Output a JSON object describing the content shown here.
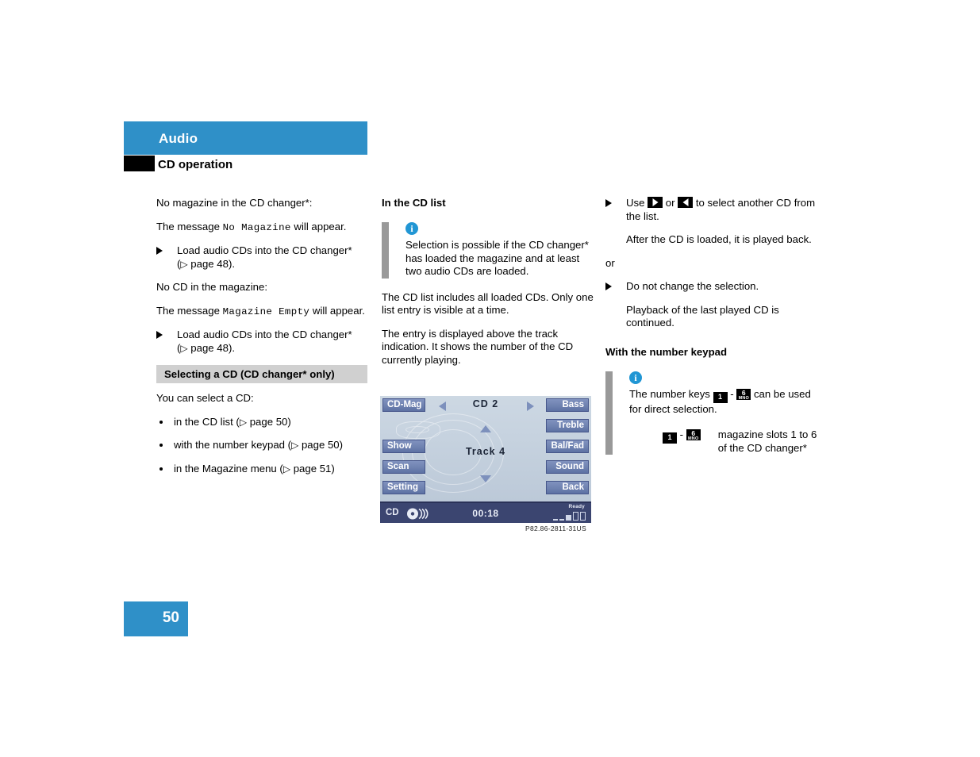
{
  "header": {
    "chapter": "Audio",
    "section": "CD operation",
    "band_color": "#2f90c8"
  },
  "page": {
    "number": "50"
  },
  "col1": {
    "p1": "No magazine in the CD changer*:",
    "p2_pre": "The message ",
    "p2_mono": "No Magazine",
    "p2_post": " will appear.",
    "step1_a": "Load audio CDs into the CD changer*",
    "step1_b_pre": "(",
    "step1_b_ref": "▷",
    "step1_b_post": " page 48).",
    "p3": "No CD in the magazine:",
    "p4_pre": "The message ",
    "p4_mono": "Magazine Empty",
    "p4_post": " will appear.",
    "step2_a": "Load audio CDs into the CD changer*",
    "step2_b_pre": "(",
    "step2_b_ref": "▷",
    "step2_b_post": " page 48).",
    "graybar": "Selecting a CD (CD changer* only)",
    "p5": "You can select a CD:",
    "bullets": [
      {
        "text": "in the CD list (",
        "ref": "▷",
        "tail": " page 50)"
      },
      {
        "text": "with the number keypad (",
        "ref": "▷",
        "tail": " page 50)"
      },
      {
        "text": "in the Magazine menu (",
        "ref": "▷",
        "tail": " page 51)"
      }
    ]
  },
  "col2": {
    "heading": "In the CD list",
    "info_icon": "info-icon",
    "info_text": "Selection is possible if the CD changer* has loaded the magazine and at least two audio CDs are loaded.",
    "p1": "The CD list includes all loaded CDs. Only one list entry is visible at a time.",
    "p2": "The entry is displayed above the track indication. It shows the number of the CD currently playing.",
    "figure_caption": "P82.86-2811-31US"
  },
  "display": {
    "left_buttons": [
      "CD-Mag",
      "Show",
      "Scan",
      "Setting"
    ],
    "right_buttons": [
      "Bass",
      "Treble",
      "Bal/Fad",
      "Sound",
      "Back"
    ],
    "center_top": "CD 2",
    "center_mid": "Track 4",
    "nav_left_icon": "nav-left-arrow-icon",
    "nav_right_icon": "nav-right-arrow-icon",
    "nav_up_icon": "nav-up-arrow-icon",
    "nav_down_icon": "nav-down-arrow-icon",
    "status_source": "CD",
    "status_time": "00:18",
    "status_ready": "Ready",
    "button_color": "#6f82b0",
    "status_bar_color": "#3b4570"
  },
  "col3": {
    "step1_pre": "Use ",
    "step1_key_right": "key-right-arrow",
    "step1_mid": " or ",
    "step1_key_left": "key-left-arrow",
    "step1_post": " to select another CD from the list.",
    "sub1": "After the CD is loaded, it is played back.",
    "or": "or",
    "step2": "Do not change the selection.",
    "sub2": "Playback of the last played CD is continued.",
    "heading": "With the number keypad",
    "info_text_pre": "The number keys ",
    "info_key1_num": "1",
    "info_key1_letters": "",
    "info_dash": " - ",
    "info_key6_num": "6",
    "info_key6_letters": "MNO",
    "info_text_post": " can be used for direct selection.",
    "keyrow_dash": " - ",
    "keyrow_text_line1": "magazine slots 1 to 6",
    "keyrow_text_line2": "of the CD changer*"
  }
}
